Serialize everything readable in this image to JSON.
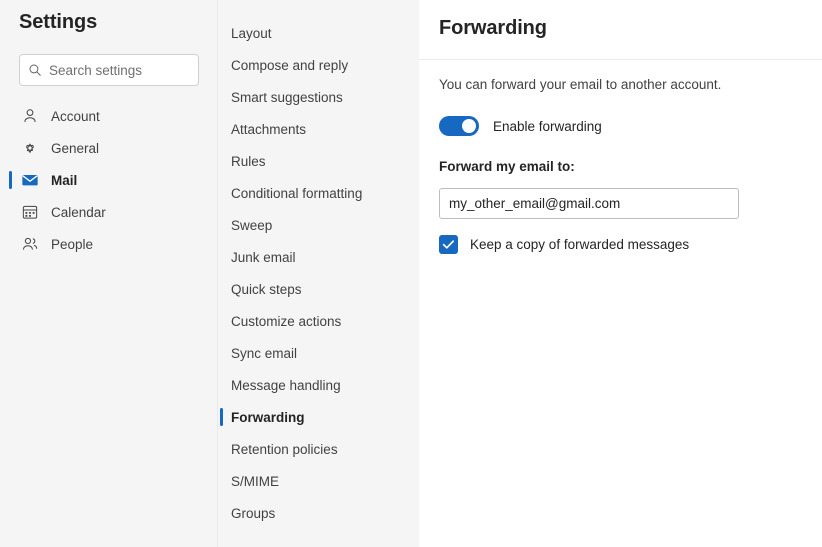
{
  "sidebar": {
    "title": "Settings",
    "search": {
      "placeholder": "Search settings",
      "value": "",
      "icon": "search-icon"
    },
    "items": [
      {
        "label": "Account",
        "icon": "person-icon",
        "selected": false
      },
      {
        "label": "General",
        "icon": "gear-icon",
        "selected": false
      },
      {
        "label": "Mail",
        "icon": "mail-icon",
        "selected": true
      },
      {
        "label": "Calendar",
        "icon": "calendar-icon",
        "selected": false
      },
      {
        "label": "People",
        "icon": "people-icon",
        "selected": false
      }
    ]
  },
  "subnav": {
    "items": [
      {
        "label": "Layout",
        "selected": false
      },
      {
        "label": "Compose and reply",
        "selected": false
      },
      {
        "label": "Smart suggestions",
        "selected": false
      },
      {
        "label": "Attachments",
        "selected": false
      },
      {
        "label": "Rules",
        "selected": false
      },
      {
        "label": "Conditional formatting",
        "selected": false
      },
      {
        "label": "Sweep",
        "selected": false
      },
      {
        "label": "Junk email",
        "selected": false
      },
      {
        "label": "Quick steps",
        "selected": false
      },
      {
        "label": "Customize actions",
        "selected": false
      },
      {
        "label": "Sync email",
        "selected": false
      },
      {
        "label": "Message handling",
        "selected": false
      },
      {
        "label": "Forwarding",
        "selected": true
      },
      {
        "label": "Retention policies",
        "selected": false
      },
      {
        "label": "S/MIME",
        "selected": false
      },
      {
        "label": "Groups",
        "selected": false
      }
    ]
  },
  "content": {
    "title": "Forwarding",
    "description": "You can forward your email to another account.",
    "toggle": {
      "label": "Enable forwarding",
      "state": "on"
    },
    "forward_to": {
      "label": "Forward my email to:",
      "value": "my_other_email@gmail.com",
      "placeholder": ""
    },
    "keep_copy": {
      "label": "Keep a copy of forwarded messages",
      "checked": true
    }
  },
  "colors": {
    "accent": "#1668c1",
    "panel_bg": "#f5f5f5",
    "content_bg": "#ffffff",
    "text_primary": "#242424",
    "text_secondary": "#424242",
    "divider": "#ebebeb"
  }
}
